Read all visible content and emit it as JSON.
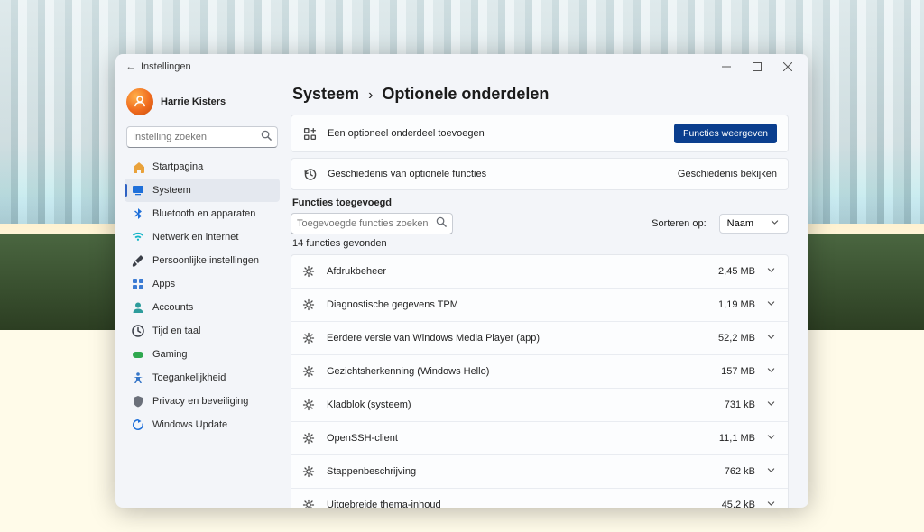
{
  "window": {
    "title": "Instellingen"
  },
  "profile": {
    "name": "Harrie Kisters"
  },
  "sidebar": {
    "search_placeholder": "Instelling zoeken",
    "items": [
      {
        "label": "Startpagina",
        "icon": "home",
        "color": "#e9a23b"
      },
      {
        "label": "Systeem",
        "icon": "system",
        "color": "#1e6fd9",
        "active": true
      },
      {
        "label": "Bluetooth en apparaten",
        "icon": "bluetooth",
        "color": "#1e6fd9"
      },
      {
        "label": "Netwerk en internet",
        "icon": "wifi",
        "color": "#13b5c7"
      },
      {
        "label": "Persoonlijke instellingen",
        "icon": "brush",
        "color": "#3b3f48"
      },
      {
        "label": "Apps",
        "icon": "apps",
        "color": "#3b7bd3"
      },
      {
        "label": "Accounts",
        "icon": "person",
        "color": "#2d9c9c"
      },
      {
        "label": "Tijd en taal",
        "icon": "clock",
        "color": "#3b3f48"
      },
      {
        "label": "Gaming",
        "icon": "game",
        "color": "#2fa84f"
      },
      {
        "label": "Toegankelijkheid",
        "icon": "access",
        "color": "#3676c8"
      },
      {
        "label": "Privacy en beveiliging",
        "icon": "shield",
        "color": "#6b707a"
      },
      {
        "label": "Windows Update",
        "icon": "update",
        "color": "#1e6fd9"
      }
    ]
  },
  "main": {
    "breadcrumb_parent": "Systeem",
    "breadcrumb_title": "Optionele onderdelen",
    "add_label": "Een optioneel onderdeel toevoegen",
    "add_button": "Functies weergeven",
    "history_label": "Geschiedenis van optionele functies",
    "history_action": "Geschiedenis bekijken",
    "features_heading": "Functies toegevoegd",
    "features_search_placeholder": "Toegevoegde functies zoeken",
    "sort_label": "Sorteren op:",
    "sort_value": "Naam",
    "count_text": "14 functies gevonden",
    "features": [
      {
        "name": "Afdrukbeheer",
        "size": "2,45 MB"
      },
      {
        "name": "Diagnostische gegevens TPM",
        "size": "1,19 MB"
      },
      {
        "name": "Eerdere versie van Windows Media Player (app)",
        "size": "52,2 MB"
      },
      {
        "name": "Gezichtsherkenning (Windows Hello)",
        "size": "157 MB"
      },
      {
        "name": "Kladblok (systeem)",
        "size": "731 kB"
      },
      {
        "name": "OpenSSH-client",
        "size": "11,1 MB"
      },
      {
        "name": "Stappenbeschrijving",
        "size": "762 kB"
      },
      {
        "name": "Uitgebreide thema-inhoud",
        "size": "45,2 kB"
      }
    ]
  }
}
